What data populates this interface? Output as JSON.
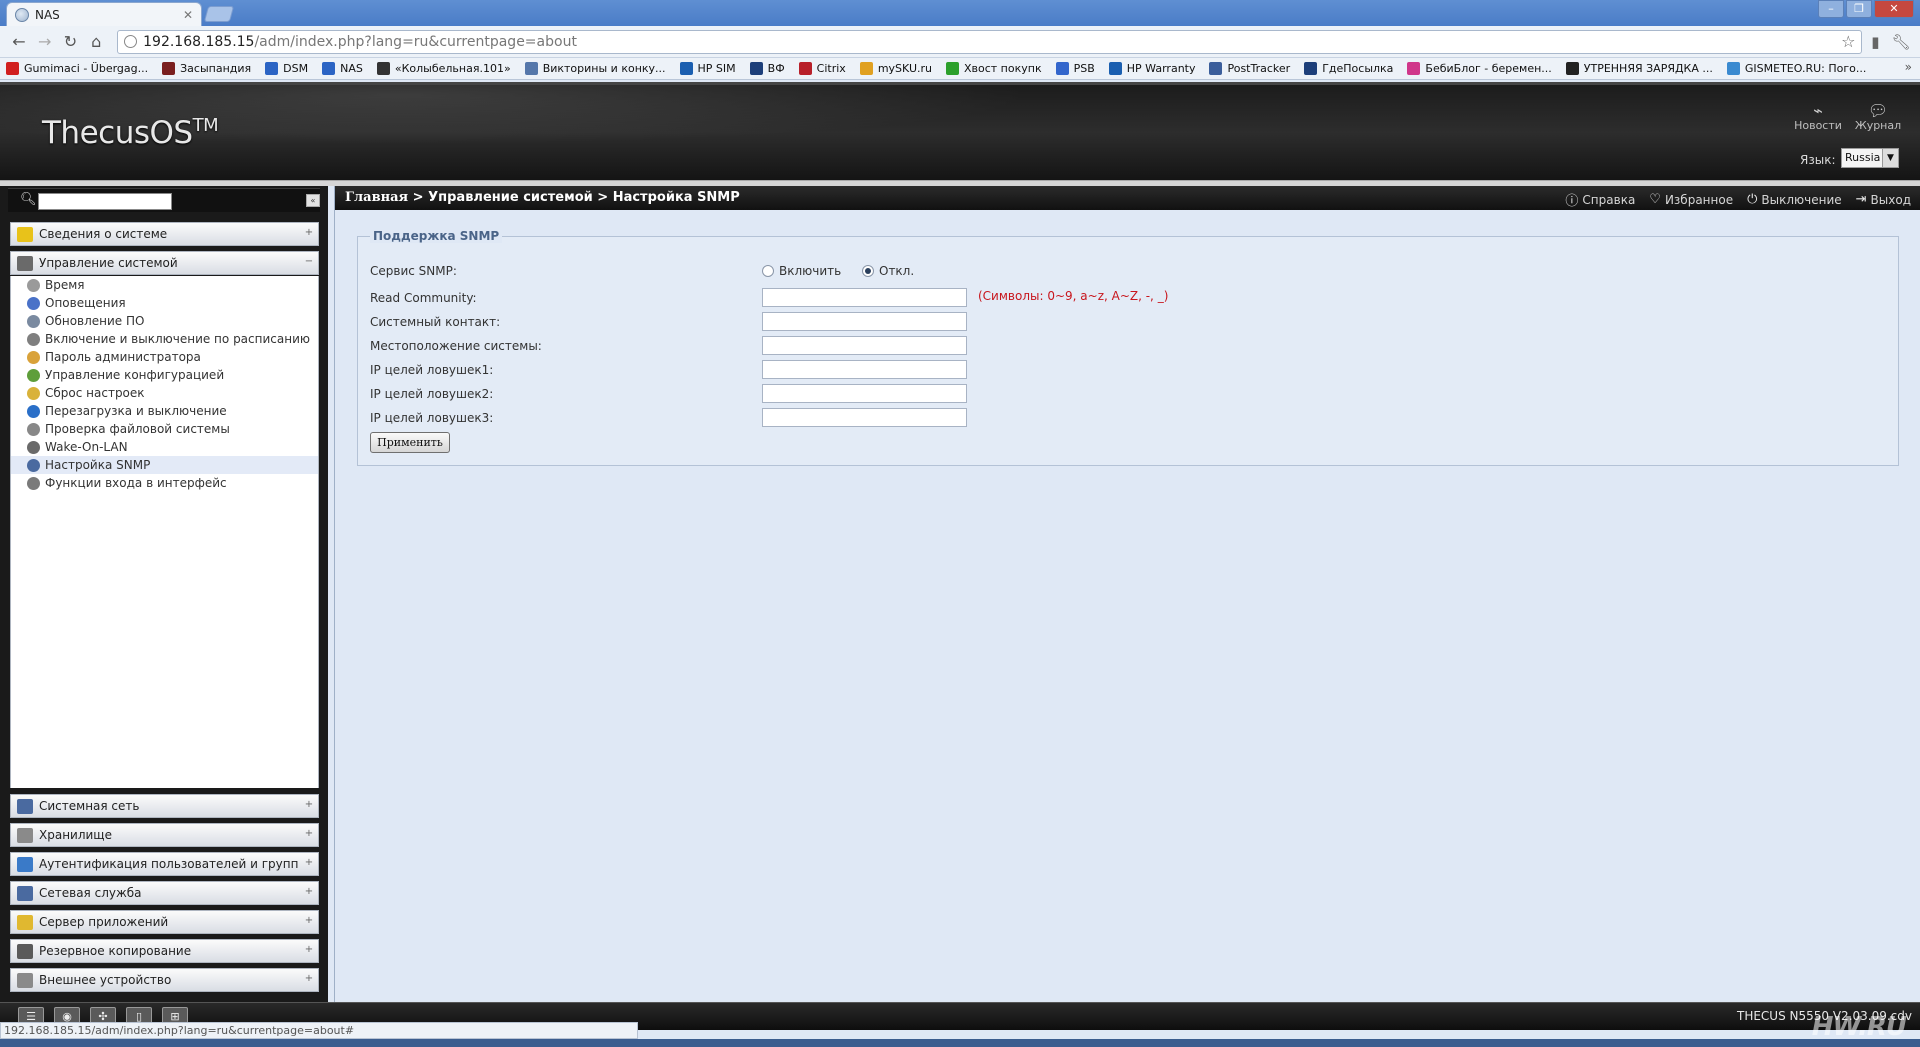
{
  "browser": {
    "tab_title": "NAS",
    "url_host": "192.168.185.15",
    "url_path": "/adm/index.php?lang=ru&currentpage=about",
    "bookmarks": [
      {
        "label": "Gumimaci - Übergag...",
        "color": "#d11f1f"
      },
      {
        "label": "Засыпандия",
        "color": "#7a1f1f"
      },
      {
        "label": "DSM",
        "color": "#2b64c4"
      },
      {
        "label": "NAS",
        "color": "#2b64c4"
      },
      {
        "label": "«Колыбельная.101»",
        "color": "#333333"
      },
      {
        "label": "Викторины и конку...",
        "color": "#5577aa"
      },
      {
        "label": "HP SIM",
        "color": "#1b5fb0"
      },
      {
        "label": "ВФ",
        "color": "#1d3f7a"
      },
      {
        "label": "Citrix",
        "color": "#b8202a"
      },
      {
        "label": "mySKU.ru",
        "color": "#e0a020"
      },
      {
        "label": "Хвост покупк",
        "color": "#2ca02c"
      },
      {
        "label": "PSB",
        "color": "#3366cc"
      },
      {
        "label": "HP Warranty",
        "color": "#1b5fb0"
      },
      {
        "label": "PostTracker",
        "color": "#3b5e9b"
      },
      {
        "label": "ГдеПосылка",
        "color": "#1d3f7a"
      },
      {
        "label": "БебиБлог - беремен...",
        "color": "#d0368a"
      },
      {
        "label": "УТРЕННЯЯ ЗАРЯДКА ...",
        "color": "#222222"
      },
      {
        "label": "GISMETEO.RU: Пого...",
        "color": "#3a8ad0"
      }
    ]
  },
  "header": {
    "logo": "ThecusOS",
    "logo_tm": "TM",
    "news": "Новости",
    "journal": "Журнал",
    "lang_label": "Язык:",
    "lang_value": "Russia"
  },
  "sidebar": {
    "top_sections": [
      {
        "label": "Сведения о системе",
        "icon_color": "#e8c21a",
        "toggle": "+"
      },
      {
        "label": "Управление системой",
        "icon_color": "#6a6a6a",
        "toggle": "−"
      }
    ],
    "items": [
      {
        "label": "Время",
        "icon_color": "#9a9a9a"
      },
      {
        "label": "Оповещения",
        "icon_color": "#4a72c8"
      },
      {
        "label": "Обновление ПО",
        "icon_color": "#7a8aa0"
      },
      {
        "label": "Включение и выключение по расписанию",
        "icon_color": "#7f7f7f"
      },
      {
        "label": "Пароль администратора",
        "icon_color": "#d9a23a"
      },
      {
        "label": "Управление конфигурацией",
        "icon_color": "#5e9e3a"
      },
      {
        "label": "Сброс настроек",
        "icon_color": "#d9b23a"
      },
      {
        "label": "Перезагрузка и выключение",
        "icon_color": "#2a6fc8"
      },
      {
        "label": "Проверка файловой системы",
        "icon_color": "#888888"
      },
      {
        "label": "Wake-On-LAN",
        "icon_color": "#6a6a6a"
      },
      {
        "label": "Настройка SNMP",
        "icon_color": "#4a6aa0"
      },
      {
        "label": "Функции входа в интерфейс",
        "icon_color": "#7a7a7a"
      }
    ],
    "bottom_sections": [
      {
        "label": "Системная сеть",
        "icon_color": "#4a6aa0"
      },
      {
        "label": "Хранилище",
        "icon_color": "#8a8a8a"
      },
      {
        "label": "Аутентификация пользователей и групп",
        "icon_color": "#3a7ac8"
      },
      {
        "label": "Сетевая служба",
        "icon_color": "#4a6aa0"
      },
      {
        "label": "Сервер приложений",
        "icon_color": "#e0b830"
      },
      {
        "label": "Резервное копирование",
        "icon_color": "#5a5a5a"
      },
      {
        "label": "Внешнее устройство",
        "icon_color": "#8a8a8a"
      }
    ]
  },
  "breadcrumb": {
    "home": "Главная",
    "sep1": ">",
    "section": "Управление системой",
    "sep2": ">",
    "page": "Настройка SNMP"
  },
  "actions": {
    "help": "Справка",
    "favorites": "Избранное",
    "shutdown": "Выключение",
    "logout": "Выход"
  },
  "snmp": {
    "legend": "Поддержка SNMP",
    "service_label": "Сервис SNMP:",
    "opt_on": "Включить",
    "opt_off": "Откл.",
    "selected": "Откл.",
    "read_community_label": "Read Community:",
    "read_community_hint": "(Символы: 0~9, a~z, A~Z, -, _)",
    "contact_label": "Системный контакт:",
    "location_label": "Местоположение системы:",
    "trap1_label": "IP целей ловушек1:",
    "trap2_label": "IP целей ловушек2:",
    "trap3_label": "IP целей ловушек3:",
    "apply": "Применить"
  },
  "footer": {
    "version": "THECUS N5550 V2.03.09.cdv",
    "status_url": "192.168.185.15/adm/index.php?lang=ru&currentpage=about#",
    "watermark": "HW.RU"
  }
}
